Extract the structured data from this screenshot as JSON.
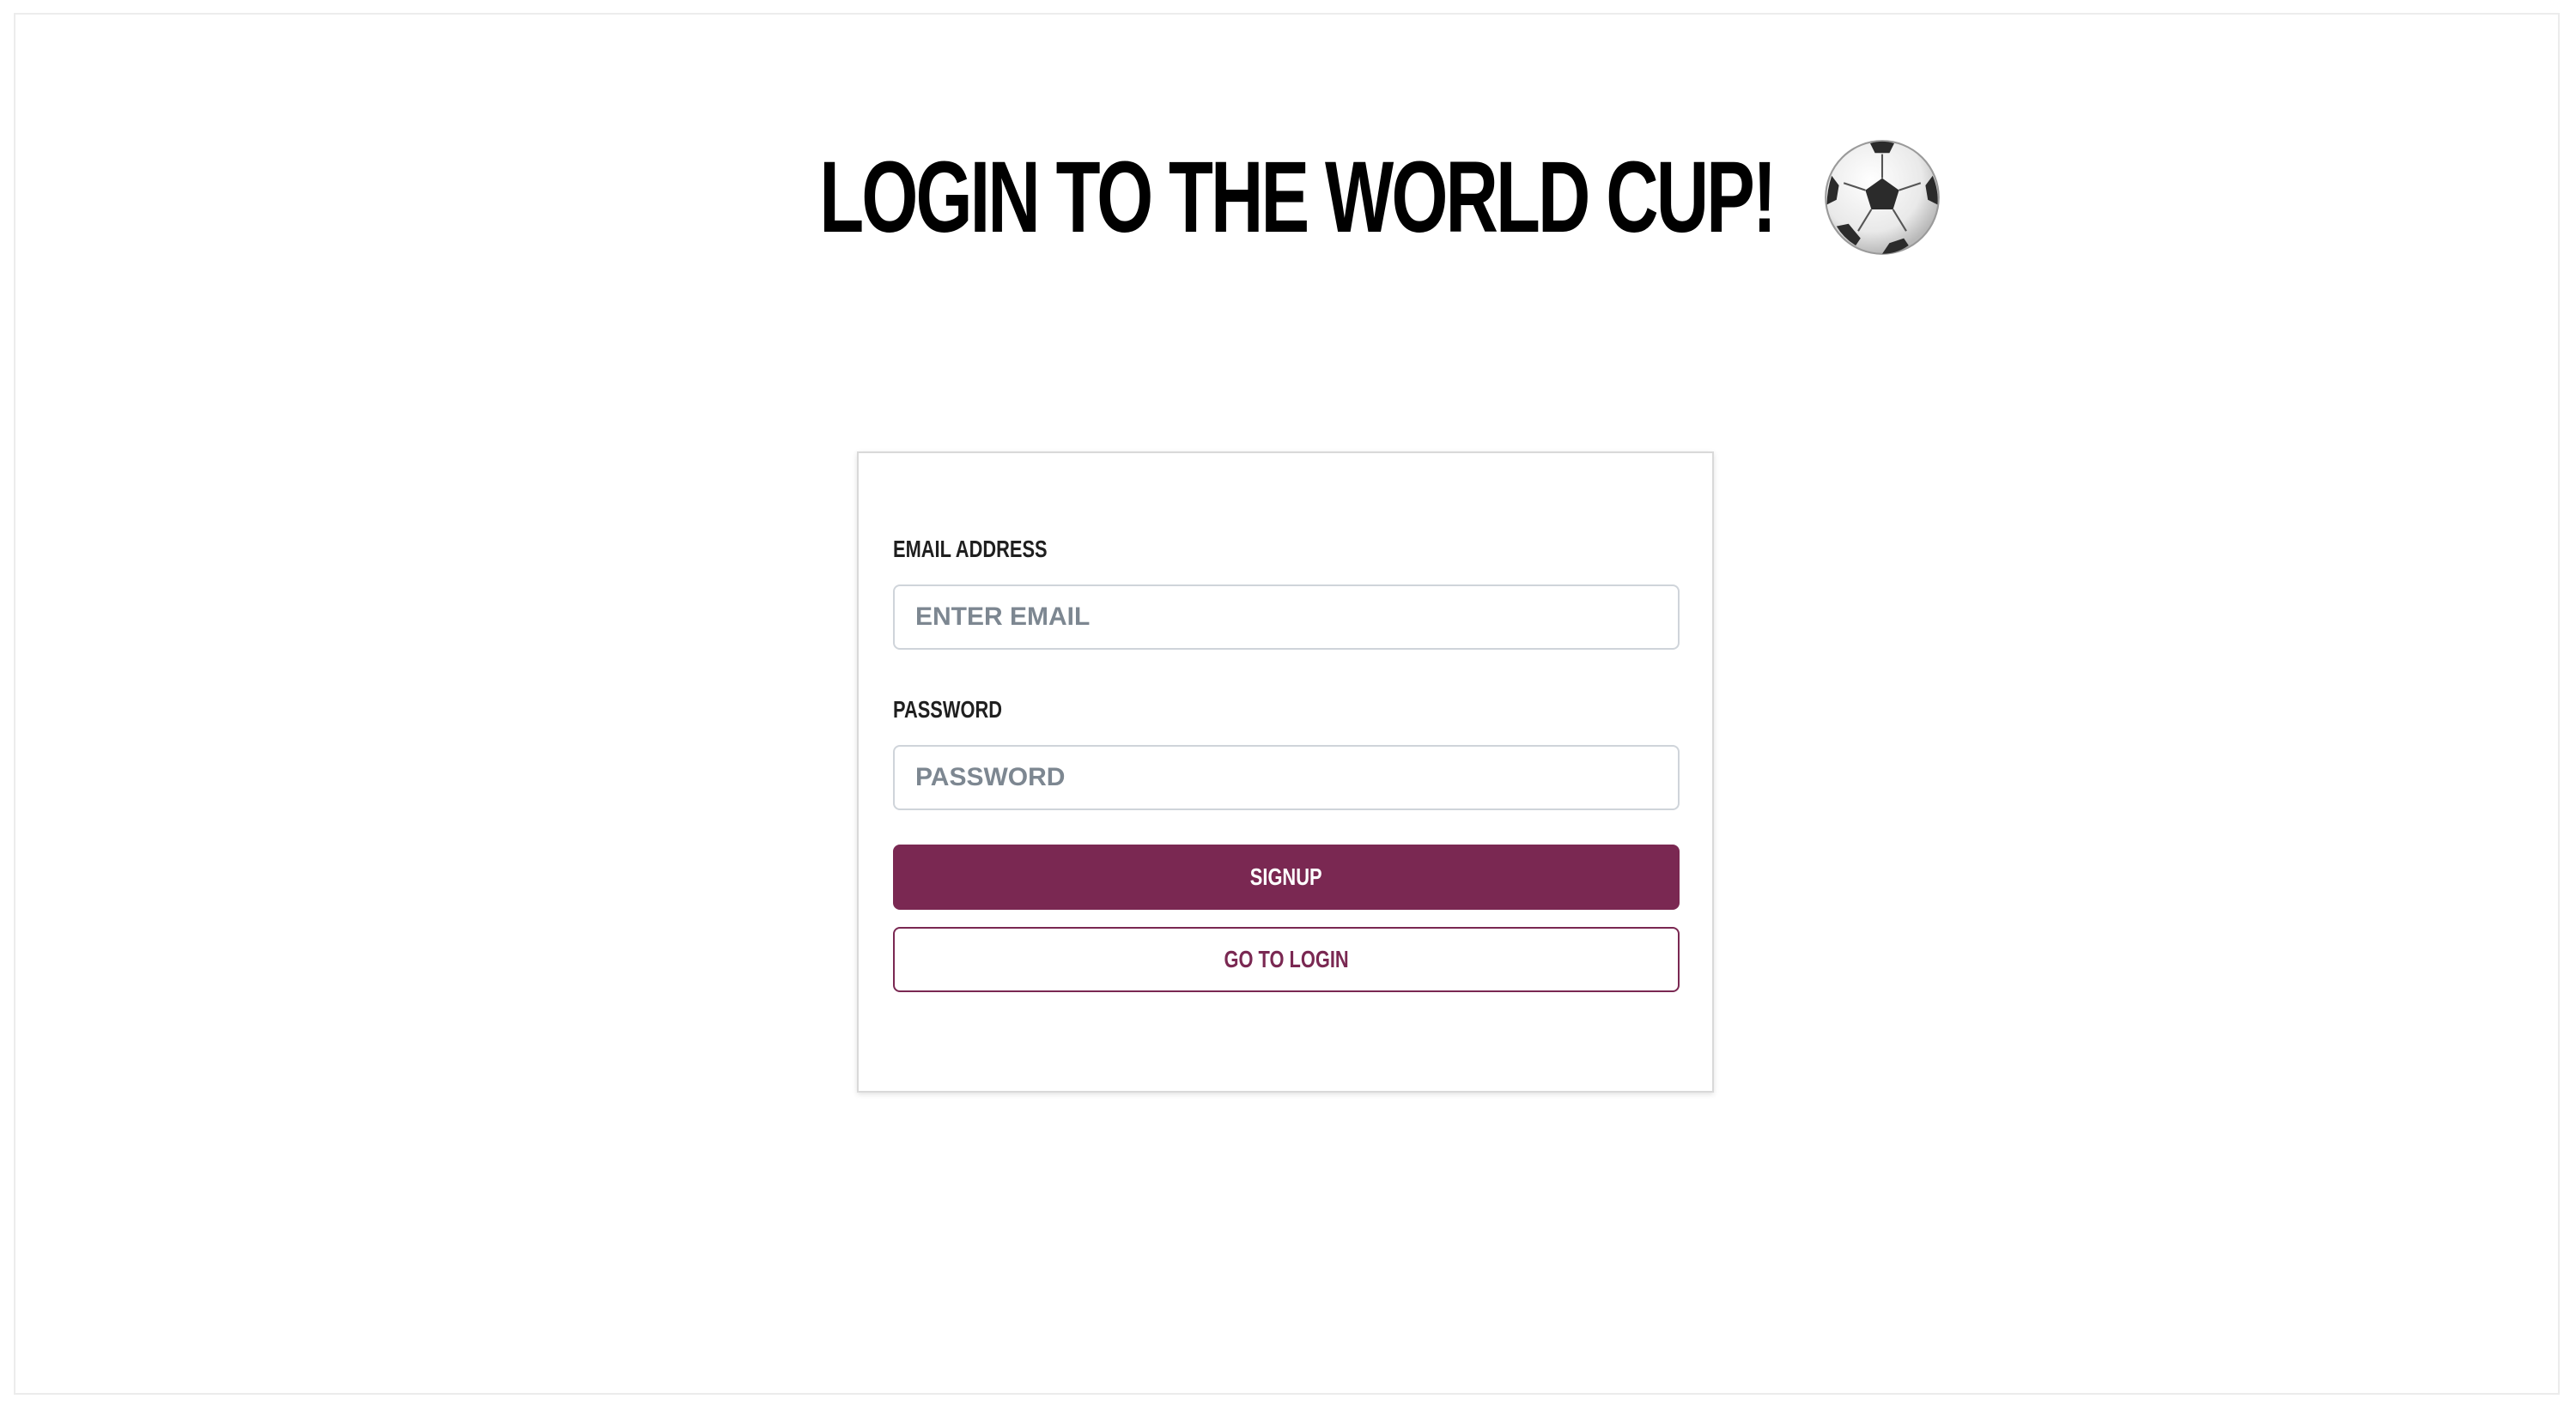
{
  "header": {
    "title": "LOGIN TO THE WORLD CUP!",
    "title_icon": "soccer-ball-icon"
  },
  "form": {
    "email": {
      "label": "EMAIL ADDRESS",
      "placeholder": "ENTER EMAIL",
      "value": ""
    },
    "password": {
      "label": "PASSWORD",
      "placeholder": "PASSWORD",
      "value": ""
    },
    "signup_label": "SIGNUP",
    "login_label": "GO TO LOGIN"
  },
  "colors": {
    "accent": "#7a2852",
    "title": "#000000",
    "input_border": "#cfd4da",
    "placeholder": "#7d8791"
  }
}
